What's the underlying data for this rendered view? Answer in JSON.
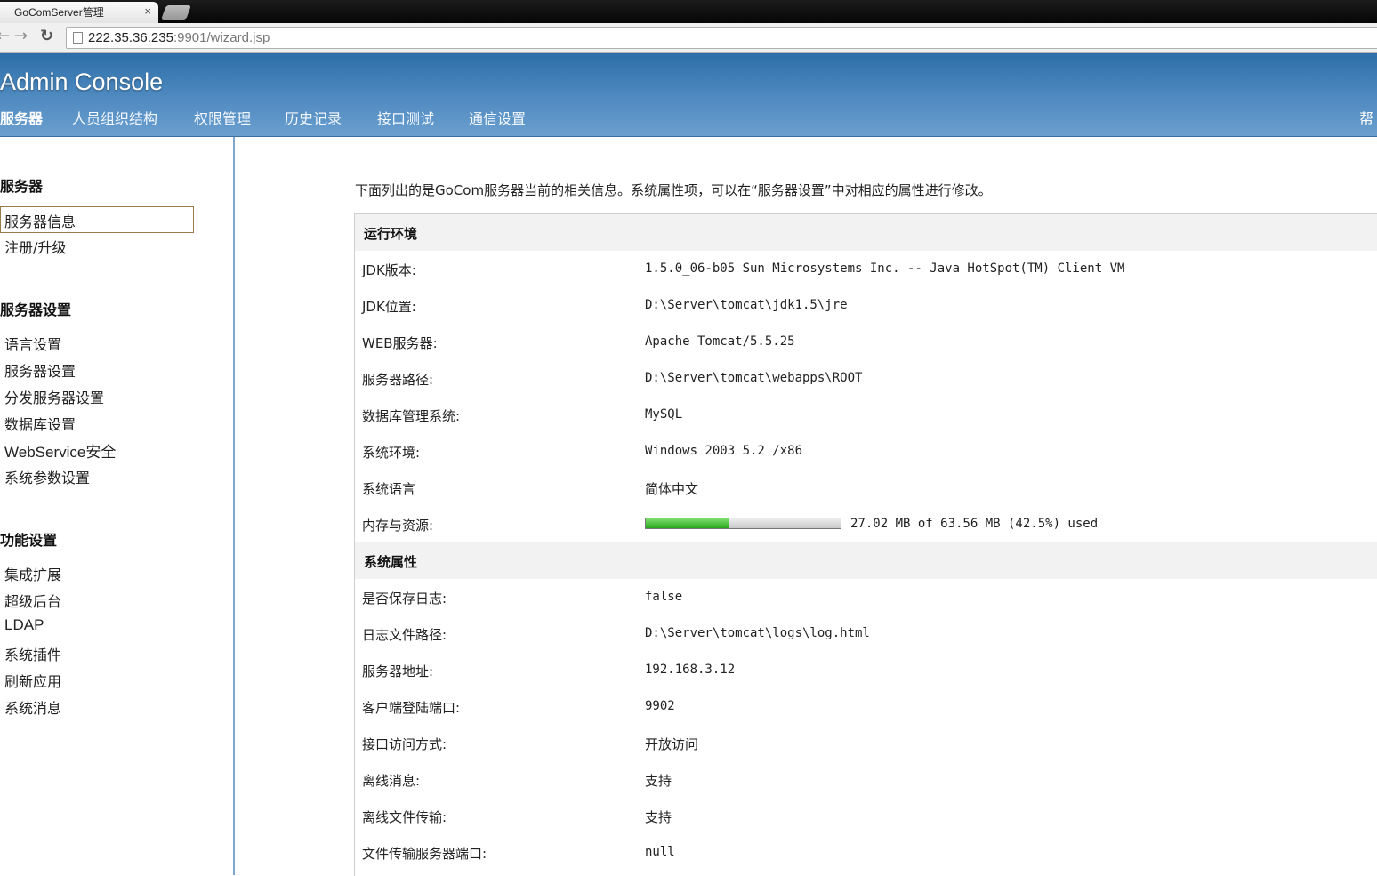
{
  "browser": {
    "tab_title": "GoComServer管理",
    "tab_close": "×",
    "url_host": "222.35.36.235",
    "url_path": ":9901/wizard.jsp"
  },
  "header": {
    "brand": "Admin Console",
    "nav": [
      "服务器",
      "人员组织结构",
      "权限管理",
      "历史记录",
      "接口测试",
      "通信设置"
    ],
    "active_nav": "服务器",
    "help": "帮"
  },
  "sidebar": {
    "sections": [
      {
        "heading": "服务器",
        "items": [
          "服务器信息",
          "注册/升级"
        ]
      },
      {
        "heading": "服务器设置",
        "items": [
          "语言设置",
          "服务器设置",
          "分发服务器设置",
          "数据库设置",
          "WebService安全",
          "系统参数设置"
        ]
      },
      {
        "heading": "功能设置",
        "items": [
          "集成扩展",
          "超级后台",
          "LDAP",
          "系统插件",
          "刷新应用",
          "系统消息"
        ]
      }
    ],
    "selected_item": "服务器信息"
  },
  "content": {
    "intro": "下面列出的是GoCom服务器当前的相关信息。系统属性项，可以在“服务器设置”中对相应的属性进行修改。",
    "runtime": {
      "title": "运行环境",
      "rows": [
        {
          "label": "JDK版本:",
          "value": "1.5.0_06-b05 Sun Microsystems Inc. -- Java HotSpot(TM) Client VM"
        },
        {
          "label": "JDK位置:",
          "value": "D:\\Server\\tomcat\\jdk1.5\\jre"
        },
        {
          "label": "WEB服务器:",
          "value": "Apache Tomcat/5.5.25"
        },
        {
          "label": "服务器路径:",
          "value": "D:\\Server\\tomcat\\webapps\\ROOT"
        },
        {
          "label": "数据库管理系统:",
          "value": "MySQL"
        },
        {
          "label": "系统环境:",
          "value": "Windows 2003 5.2  /x86"
        },
        {
          "label": "系统语言",
          "value": "简体中文"
        }
      ],
      "memory": {
        "label": "内存与资源:",
        "used_fraction": 0.425,
        "text": "27.02 MB of 63.56 MB (42.5%) used",
        "bar_color": "#3cbb2c"
      }
    },
    "system": {
      "title": "系统属性",
      "rows": [
        {
          "label": "是否保存日志:",
          "value": "false"
        },
        {
          "label": "日志文件路径:",
          "value": "D:\\Server\\tomcat\\logs\\log.html"
        },
        {
          "label": "服务器地址:",
          "value": "192.168.3.12"
        },
        {
          "label": "客户端登陆端口:",
          "value": "9902"
        },
        {
          "label": "接口访问方式:",
          "value": "开放访问"
        },
        {
          "label": "离线消息:",
          "value": "支持"
        },
        {
          "label": "离线文件传输:",
          "value": "支持"
        },
        {
          "label": "文件传输服务器端口:",
          "value": "null"
        }
      ]
    }
  },
  "colors": {
    "header_top": "#2d6ea8",
    "header_bottom": "#6b9fcf",
    "section_bg": "#f2f2f2",
    "selected_border": "#9b7b4e"
  }
}
